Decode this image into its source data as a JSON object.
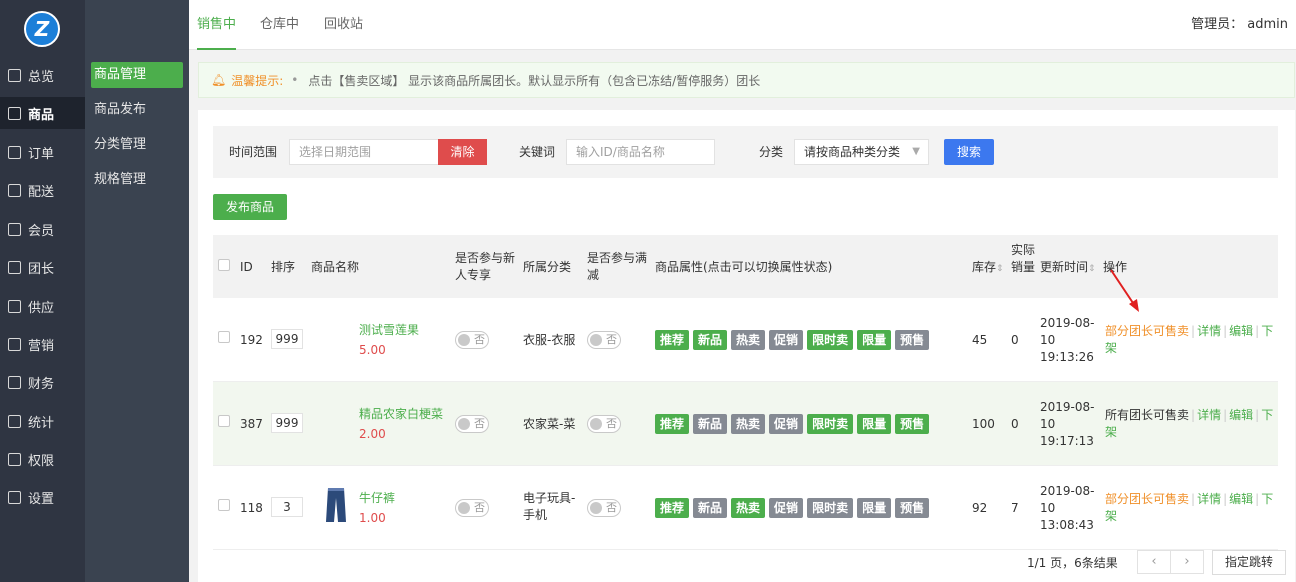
{
  "sidebar": {
    "logo": "Z",
    "items": [
      {
        "label": "总览"
      },
      {
        "label": "商品"
      },
      {
        "label": "订单"
      },
      {
        "label": "配送"
      },
      {
        "label": "会员"
      },
      {
        "label": "团长"
      },
      {
        "label": "供应"
      },
      {
        "label": "营销"
      },
      {
        "label": "财务"
      },
      {
        "label": "统计"
      },
      {
        "label": "权限"
      },
      {
        "label": "设置"
      }
    ]
  },
  "subnav": {
    "items": [
      {
        "label": "商品管理"
      },
      {
        "label": "商品发布"
      },
      {
        "label": "分类管理"
      },
      {
        "label": "规格管理"
      }
    ]
  },
  "topbar": {
    "tabs": [
      {
        "label": "销售中"
      },
      {
        "label": "仓库中"
      },
      {
        "label": "回收站"
      }
    ],
    "admin": "管理员： admin"
  },
  "notice": {
    "title": "温馨提示:",
    "dot": "•",
    "text": "点击【售卖区域】 显示该商品所属团长。默认显示所有（包含已冻结/暂停服务）团长"
  },
  "filter": {
    "time_label": "时间范围",
    "date_placeholder": "选择日期范围",
    "clear": "清除",
    "keyword_label": "关键词",
    "keyword_placeholder": "输入ID/商品名称",
    "category_label": "分类",
    "category_value": "请按商品种类分类",
    "search": "搜索"
  },
  "publish_button": "发布商品",
  "table": {
    "headers": {
      "id": "ID",
      "sort": "排序",
      "name": "商品名称",
      "newbie_1": "是否参与新",
      "newbie_2": "人专享",
      "category": "所属分类",
      "fullcut_1": "是否参与满",
      "fullcut_2": "减",
      "attrs": "商品属性(点击可以切换属性状态)",
      "stock": "库存",
      "sold_1": "实际",
      "sold_2": "销量",
      "updated": "更新时间",
      "ops": "操作"
    },
    "switch_text": "否",
    "tag_labels": [
      "推荐",
      "新品",
      "热卖",
      "促销",
      "限时卖",
      "限量",
      "预售"
    ],
    "rows": [
      {
        "id": "192",
        "sort": "999",
        "name": "测试雪莲果",
        "price": "5.00",
        "category_1": "衣服-衣服",
        "category_2": "",
        "tags_on": [
          true,
          true,
          false,
          false,
          true,
          true,
          false
        ],
        "stock": "45",
        "sold": "0",
        "date": "2019-08-",
        "day": "10",
        "time": "19:13:26",
        "op_scope": "部分团长可售卖",
        "op_detail": "详情",
        "op_edit": "编辑",
        "op_down_1": "下",
        "op_down_2": "架",
        "scope_color": "orange"
      },
      {
        "id": "387",
        "sort": "999",
        "name": "精品农家白梗菜",
        "price": "2.00",
        "category_1": "农家菜-菜",
        "category_2": "",
        "tags_on": [
          true,
          false,
          false,
          false,
          true,
          true,
          true
        ],
        "stock": "100",
        "sold": "0",
        "date": "2019-08-",
        "day": "10",
        "time": "19:17:13",
        "op_scope": "所有团长可售卖",
        "op_detail": "详情",
        "op_edit": "编辑",
        "op_down_1": "下",
        "op_down_2": "架",
        "scope_color": "black"
      },
      {
        "id": "118",
        "sort": "3",
        "name": "牛仔裤",
        "price": "1.00",
        "category_1": "电子玩具-",
        "category_2": "手机",
        "tags_on": [
          true,
          false,
          true,
          false,
          false,
          false,
          false
        ],
        "stock": "92",
        "sold": "7",
        "date": "2019-08-",
        "day": "10",
        "time": "13:08:43",
        "op_scope": "部分团长可售卖",
        "op_detail": "详情",
        "op_edit": "编辑",
        "op_down_1": "下",
        "op_down_2": "架",
        "scope_color": "orange"
      }
    ]
  },
  "pager": {
    "summary": "1/1 页，6条结果",
    "prev": "‹",
    "next": "›",
    "jump": "指定跳转"
  },
  "colors": {
    "green": "#4cae4c",
    "red": "#df4c4c",
    "blue": "#3c78ef",
    "orange": "#f0902a",
    "sidebar": "#2f3542"
  }
}
